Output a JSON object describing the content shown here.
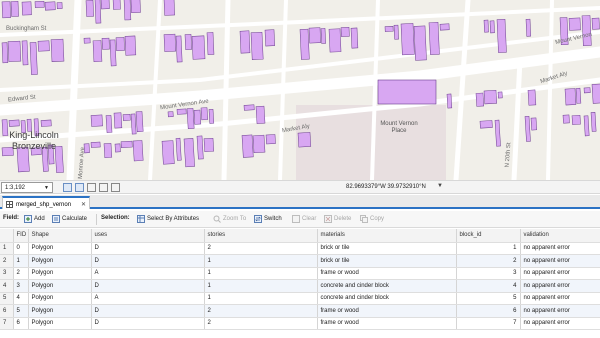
{
  "map": {
    "streets": [
      "Buckingham St",
      "Mount Vernon",
      "Market Aly",
      "Edward St",
      "Mount Vernon Ave",
      "Market Aly",
      "Monroe Ave",
      "N 20th St"
    ],
    "neighborhood": "King-Lincoln Bronzeville",
    "place": "Mount Vernon Place",
    "building_color": "#d8a7f2",
    "building_stroke": "#6a3d8c",
    "road_color": "#ffffff",
    "block_color": "#f1efe9",
    "parking_color": "#e8dfe0"
  },
  "statusbar": {
    "scale": "1:3,192",
    "coords": "82.9693379°W 39.9732910°N"
  },
  "table_tab": {
    "label": "merged_shp_vernon"
  },
  "toolbar": {
    "field_label": "Field:",
    "add": "Add",
    "calculate": "Calculate",
    "selection_label": "Selection:",
    "select_by_attributes": "Select By Attributes",
    "zoom_to": "Zoom To",
    "switch": "Switch",
    "clear": "Clear",
    "delete": "Delete",
    "copy": "Copy"
  },
  "table": {
    "columns": [
      "FID",
      "Shape",
      "uses",
      "stories",
      "materials",
      "block_id",
      "validation"
    ],
    "rows": [
      {
        "n": "1",
        "fid": "0",
        "shape": "Polygon",
        "uses": "D",
        "stories": "2",
        "materials": "brick or tile",
        "block_id": "1",
        "validation": "no apparent error"
      },
      {
        "n": "2",
        "fid": "1",
        "shape": "Polygon",
        "uses": "D",
        "stories": "1",
        "materials": "brick or tile",
        "block_id": "2",
        "validation": "no apparent error"
      },
      {
        "n": "3",
        "fid": "2",
        "shape": "Polygon",
        "uses": "A",
        "stories": "1",
        "materials": "frame or wood",
        "block_id": "3",
        "validation": "no apparent error"
      },
      {
        "n": "4",
        "fid": "3",
        "shape": "Polygon",
        "uses": "D",
        "stories": "1",
        "materials": "concrete and cinder block",
        "block_id": "4",
        "validation": "no apparent error"
      },
      {
        "n": "5",
        "fid": "4",
        "shape": "Polygon",
        "uses": "A",
        "stories": "1",
        "materials": "concrete and cinder block",
        "block_id": "5",
        "validation": "no apparent error"
      },
      {
        "n": "6",
        "fid": "5",
        "shape": "Polygon",
        "uses": "D",
        "stories": "2",
        "materials": "frame or wood",
        "block_id": "6",
        "validation": "no apparent error"
      },
      {
        "n": "7",
        "fid": "6",
        "shape": "Polygon",
        "uses": "D",
        "stories": "2",
        "materials": "frame or wood",
        "block_id": "7",
        "validation": "no apparent error"
      }
    ]
  }
}
